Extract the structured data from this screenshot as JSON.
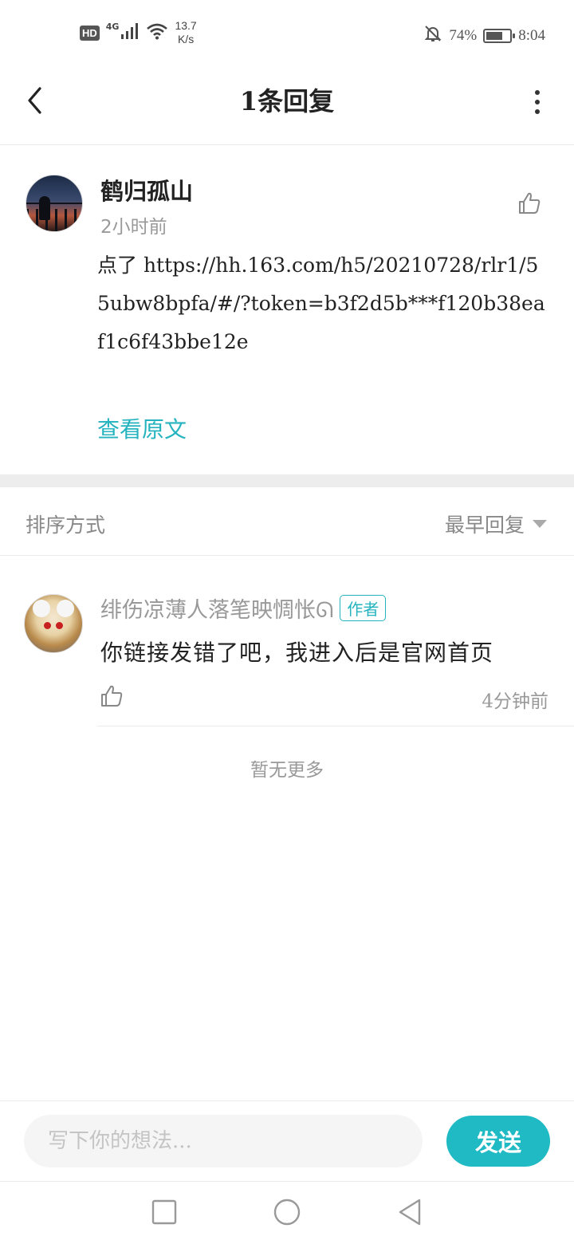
{
  "status_bar": {
    "hd": "HD",
    "network": "4G",
    "speed_value": "13.7",
    "speed_unit": "K/s",
    "battery": "74%",
    "battery_level": 0.74,
    "time": "8:04"
  },
  "header": {
    "title": "1条回复"
  },
  "original_comment": {
    "user": "鹤归孤山",
    "time": "2小时前",
    "text": "点了 https://hh.163.com/h5/20210728/rlr1/55ubw8bpfa/#/?token=b3f2d5b***f120b38eaf1c6f43bbe12e",
    "view_original": "查看原文"
  },
  "sort": {
    "label": "排序方式",
    "value": "最早回复"
  },
  "reply": {
    "user": "绯伤凉薄人落笔映惆怅ᘏ",
    "badge": "作者",
    "text": "你链接发错了吧，我进入后是官网首页",
    "time": "4分钟前"
  },
  "no_more": "暂无更多",
  "input": {
    "placeholder": "写下你的想法...",
    "send": "发送"
  },
  "colors": {
    "accent": "#25b4bf",
    "send_button": "#1fbac4"
  }
}
